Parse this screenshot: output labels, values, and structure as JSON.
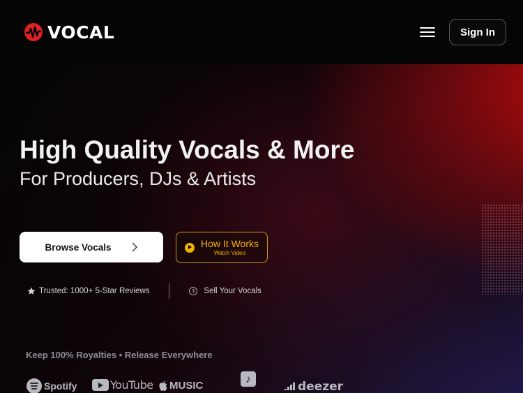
{
  "brand": {
    "name": "VOCAL",
    "logo_icon": "soundwave-logo-icon",
    "accent": "#e02020"
  },
  "header": {
    "menu_icon": "hamburger-menu-icon",
    "signin_label": "Sign In"
  },
  "hero": {
    "headline": "High Quality Vocals & More",
    "subheadline": "For Producers, DJs & Artists",
    "browse_button": {
      "label": "Browse Vocals",
      "icon": "chevron-right-icon"
    },
    "how_it_works_button": {
      "label": "How It Works",
      "sublabel": "Watch Video",
      "icon": "play-icon",
      "color": "#f2b400"
    },
    "trust": {
      "reviews": "Trusted: 1000+ 5-Star Reviews",
      "reviews_icon": "star-icon",
      "sell": "Sell Your Vocals",
      "sell_icon": "coin-icon"
    },
    "royalties": "Keep 100% Royalties • Release Everywhere",
    "platforms": [
      {
        "name": "Spotify",
        "icon": "spotify-icon"
      },
      {
        "name": "YouTube",
        "icon": "youtube-icon"
      },
      {
        "name": "MUSIC",
        "icon": "apple-icon"
      },
      {
        "name": "",
        "icon": "tiktok-icon"
      },
      {
        "name": "deezer",
        "icon": "deezer-icon"
      }
    ]
  }
}
